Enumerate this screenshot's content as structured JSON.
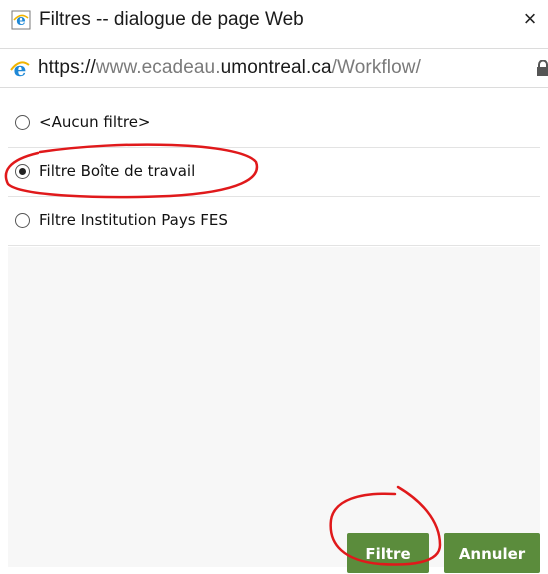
{
  "window": {
    "title": "Filtres -- dialogue de page Web",
    "close_glyph": "×",
    "title_icon": "ie-page-icon",
    "close_icon": "close-icon"
  },
  "address_bar": {
    "scheme": "https://",
    "host_prefix": "www.ecadeau.",
    "host_main": "umontreal.ca",
    "path": "/Workflow/",
    "browser_icon": "ie-icon",
    "lock_icon": "lock-icon"
  },
  "filters": {
    "options": [
      {
        "label": "<Aucun filtre>",
        "selected": false
      },
      {
        "label": "Filtre Boîte de travail",
        "selected": true
      },
      {
        "label": "Filtre Institution Pays FES",
        "selected": false
      }
    ]
  },
  "buttons": {
    "filter_label": "Filtre",
    "cancel_label": "Annuler"
  },
  "colors": {
    "button_green": "#5b8c3c",
    "annotation_red": "#e0191b",
    "ie_blue": "#1e88d6"
  }
}
